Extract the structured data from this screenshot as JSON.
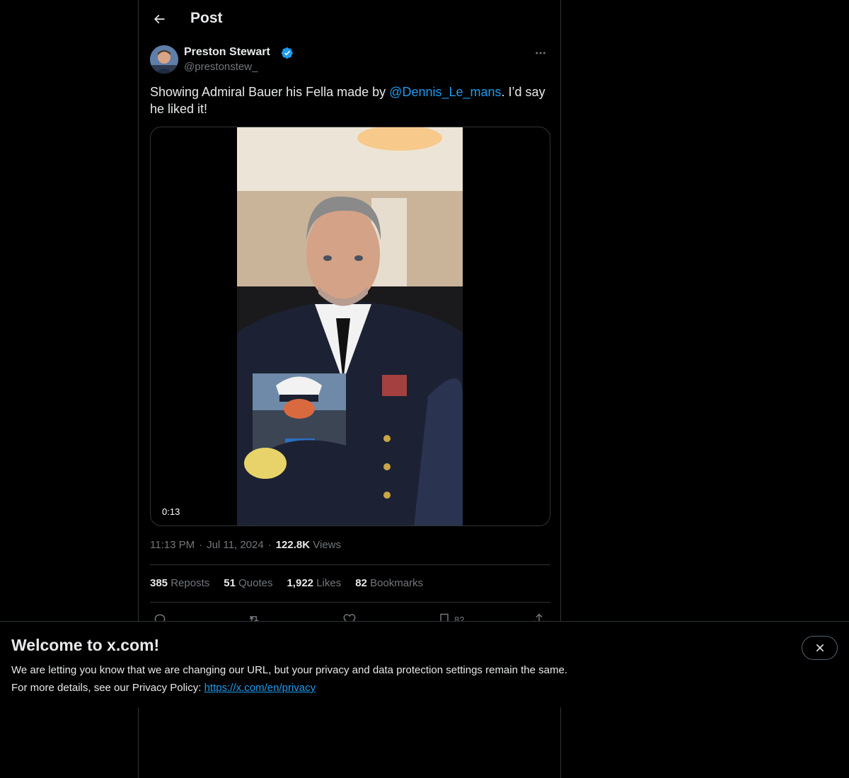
{
  "header": {
    "back_icon": "arrow-left-icon",
    "title": "Post"
  },
  "post": {
    "author": {
      "display_name": "Preston Stewart",
      "handle": "@prestonstew_",
      "verified": true,
      "verified_icon": "verified-badge-icon"
    },
    "more_icon": "more-horizontal-icon",
    "text_before_mention": "Showing Admiral Bauer his Fella made by ",
    "mention": "@Dennis_Le_mans",
    "text_after_mention": ".  I’d say he liked it!",
    "media": {
      "type": "video",
      "duration": "0:13"
    },
    "time": "11:13 PM",
    "date": "Jul 11, 2024",
    "views_count": "122.8K",
    "views_label": "Views",
    "stats": {
      "reposts_count": "385",
      "reposts_label": "Reposts",
      "quotes_count": "51",
      "quotes_label": "Quotes",
      "likes_count": "1,922",
      "likes_label": "Likes",
      "bookmarks_count": "82",
      "bookmarks_label": "Bookmarks"
    },
    "actions": {
      "reply_icon": "reply-icon",
      "repost_icon": "repost-icon",
      "like_icon": "heart-icon",
      "bookmark_icon": "bookmark-icon",
      "bookmark_count": "82",
      "share_icon": "share-icon"
    }
  },
  "banner": {
    "title": "Welcome to x.com!",
    "line1": "We are letting you know that we are changing our URL, but your privacy and data protection settings remain the same.",
    "line2_prefix": "For more details, see our Privacy Policy: ",
    "link": "https://x.com/en/privacy",
    "close_icon": "close-icon"
  },
  "colors": {
    "background": "#000000",
    "text": "#e7e9ea",
    "secondary_text": "#71767b",
    "accent": "#1d9bf0",
    "border": "#2f3336"
  }
}
